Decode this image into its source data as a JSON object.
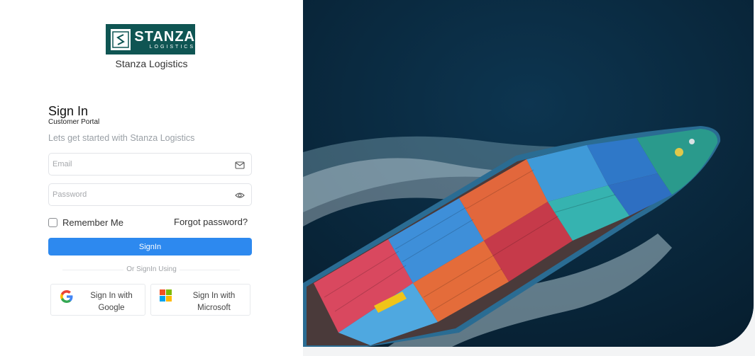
{
  "brand": {
    "logo_main": "STANZA",
    "logo_sub": "LOGISTICS",
    "name": "Stanza Logistics",
    "color": "#0f5553"
  },
  "signin": {
    "title": "Sign In",
    "subtitle": "Customer Portal",
    "tagline": "Lets get started with Stanza Logistics",
    "email_placeholder": "Email",
    "email_value": "",
    "password_placeholder": "Password",
    "password_value": "",
    "remember_label": "Remember Me",
    "remember_checked": false,
    "forgot_label": "Forgot password?",
    "button_label": "SignIn",
    "button_color": "#2d89ef",
    "divider_text": "Or SignIn Using"
  },
  "social": {
    "google_label": "Sign In with\nGoogle",
    "microsoft_label": "Sign In with\nMicrosoft"
  },
  "icons": {
    "email": "mail-icon",
    "password": "eye-icon",
    "google": "google-icon",
    "microsoft": "microsoft-icon"
  }
}
